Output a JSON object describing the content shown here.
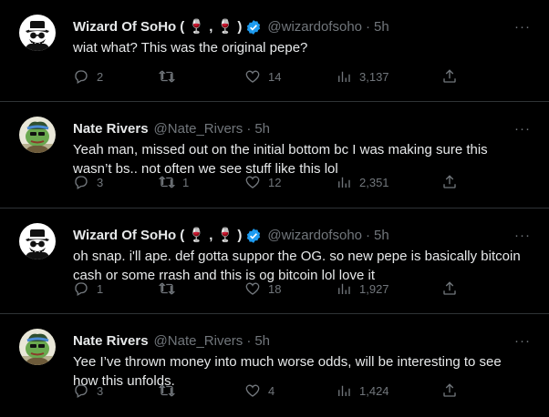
{
  "tweets": [
    {
      "author": "Wizard Of SoHo",
      "name_emoji": "( 🍷 , 🍷 )",
      "verified": true,
      "handle": "@wizardofsoho",
      "dot": "·",
      "time": "5h",
      "text": "wiat what? This was the original pepe?",
      "replies": "2",
      "retweets": "",
      "likes": "14",
      "views": "3,137",
      "avatar": "wizard-avatar"
    },
    {
      "author": "Nate Rivers",
      "name_emoji": "",
      "verified": false,
      "handle": "@Nate_Rivers",
      "dot": "·",
      "time": "5h",
      "text": "Yeah man, missed out on the initial bottom bc I was making sure this wasn’t bs.. not often we see stuff like this lol",
      "replies": "3",
      "retweets": "1",
      "likes": "12",
      "views": "2,351",
      "avatar": "pepe-avatar"
    },
    {
      "author": "Wizard Of SoHo",
      "name_emoji": "( 🍷 , 🍷 )",
      "verified": true,
      "handle": "@wizardofsoho",
      "dot": "·",
      "time": "5h",
      "text": "oh snap. i'll ape. def gotta suppor the OG. so new pepe is basically bitcoin cash or some rrash and this is og bitcoin lol love it",
      "replies": "1",
      "retweets": "",
      "likes": "18",
      "views": "1,927",
      "avatar": "wizard-avatar"
    },
    {
      "author": "Nate Rivers",
      "name_emoji": "",
      "verified": false,
      "handle": "@Nate_Rivers",
      "dot": "·",
      "time": "5h",
      "text": "Yee I’ve thrown money into much worse odds, will be interesting to see how this unfolds.",
      "replies": "3",
      "retweets": "",
      "likes": "4",
      "views": "1,424",
      "avatar": "pepe-avatar"
    }
  ],
  "more_label": "···",
  "colors": {
    "background": "#000000",
    "text": "#e7e9ea",
    "muted": "#71767b",
    "verified": "#1d9bf0",
    "divider": "#2f3336"
  }
}
